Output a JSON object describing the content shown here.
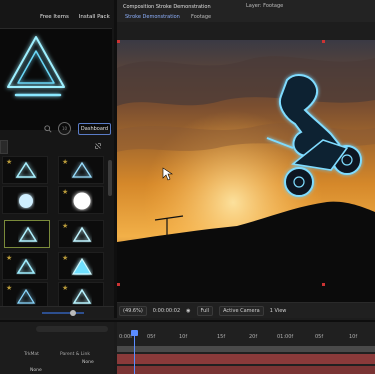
{
  "left_panel": {
    "links": {
      "free_items": "Free Items",
      "install_pack": "Install Pack"
    },
    "toolbar": {
      "dashboard_label": "Dashboard",
      "circle_label": "10"
    },
    "grid_items": [
      {
        "icon": "triangle-light-icon",
        "starred": true
      },
      {
        "icon": "triangle-outline-icon",
        "starred": true
      },
      {
        "icon": "glow-orb-icon",
        "starred": false
      },
      {
        "icon": "glow-orb-large-icon",
        "starred": true
      },
      {
        "icon": "triangle-light-icon",
        "starred": false,
        "selected": true
      },
      {
        "icon": "triangle-light-icon",
        "starred": true
      },
      {
        "icon": "triangle-light-icon",
        "starred": true
      },
      {
        "icon": "triangle-bright-icon",
        "starred": true
      },
      {
        "icon": "triangle-outline-icon",
        "starred": true
      },
      {
        "icon": "triangle-light-icon",
        "starred": true
      }
    ],
    "accent_color": "#5a7cc7"
  },
  "viewer": {
    "tabs": {
      "composition": "Composition Stroke Demonstration",
      "layer": "Layer: Footage",
      "sub_comp": "Stroke Demonstration",
      "sub_footage": "Footage"
    },
    "controls": {
      "zoom": "(49.6%)",
      "timecode": "0:00:00:02",
      "quality": "Full",
      "camera": "Active Camera",
      "views": "1 View"
    }
  },
  "timeline": {
    "ruler_labels": [
      "0:00f",
      "05f",
      "10f",
      "15f",
      "20f",
      "01:00f",
      "05f",
      "10f"
    ],
    "header": {
      "trkmat": "TrkMat",
      "parent": "Parent & Link"
    },
    "rows": [
      {
        "value": "None"
      },
      {
        "value": "None"
      }
    ],
    "bar_color": "#8a3a3a"
  }
}
